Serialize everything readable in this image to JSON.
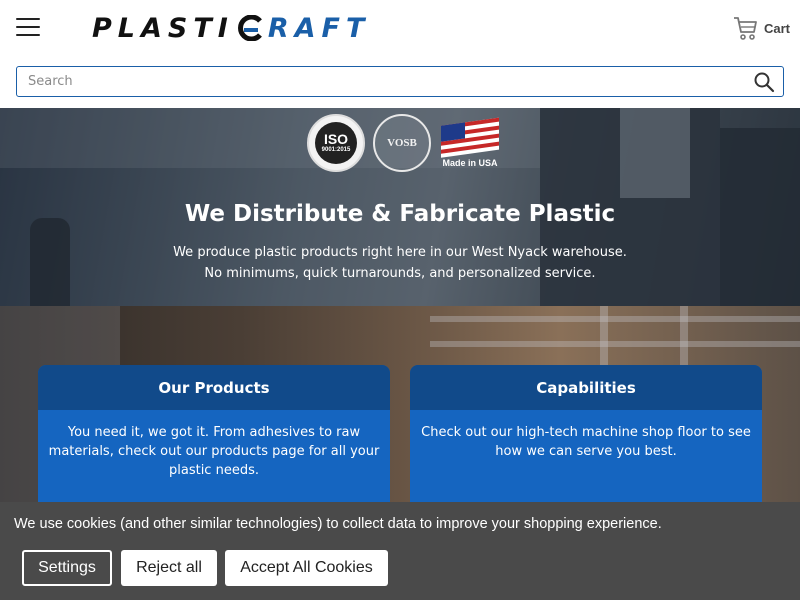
{
  "header": {
    "logo": {
      "part1": "PLASTI",
      "part2": "RAFT"
    },
    "cart_label": "Cart"
  },
  "search": {
    "placeholder": "Search"
  },
  "hero": {
    "badges": [
      {
        "name": "iso",
        "lines": [
          "ISO",
          "9001:2015"
        ]
      },
      {
        "name": "vosb",
        "text": "VOSB"
      },
      {
        "name": "usa",
        "text": "Made in USA"
      }
    ],
    "title": "We Distribute & Fabricate Plastic",
    "subtitle_line1": "We produce plastic products right here in our West Nyack warehouse.",
    "subtitle_line2": "No minimums, quick turnarounds, and personalized service."
  },
  "cards": [
    {
      "title": "Our Products",
      "body": "You need it, we got it. From adhesives to raw materials, check out our products page for all your plastic needs."
    },
    {
      "title": "Capabilities",
      "body": "Check out our high-tech machine shop floor to see how we can serve you best."
    }
  ],
  "cookie_banner": {
    "text": "We use cookies (and other similar technologies) to collect data to improve your shopping experience.",
    "settings_label": "Settings",
    "reject_label": "Reject all",
    "accept_label": "Accept All Cookies"
  },
  "colors": {
    "brand_blue": "#1a5fa8",
    "card_header": "#114a8a",
    "card_body": "#1565c0",
    "cookie_bg": "#4a4a4a"
  },
  "icons": {
    "menu": "hamburger-icon",
    "cart": "cart-icon",
    "search": "search-icon"
  }
}
